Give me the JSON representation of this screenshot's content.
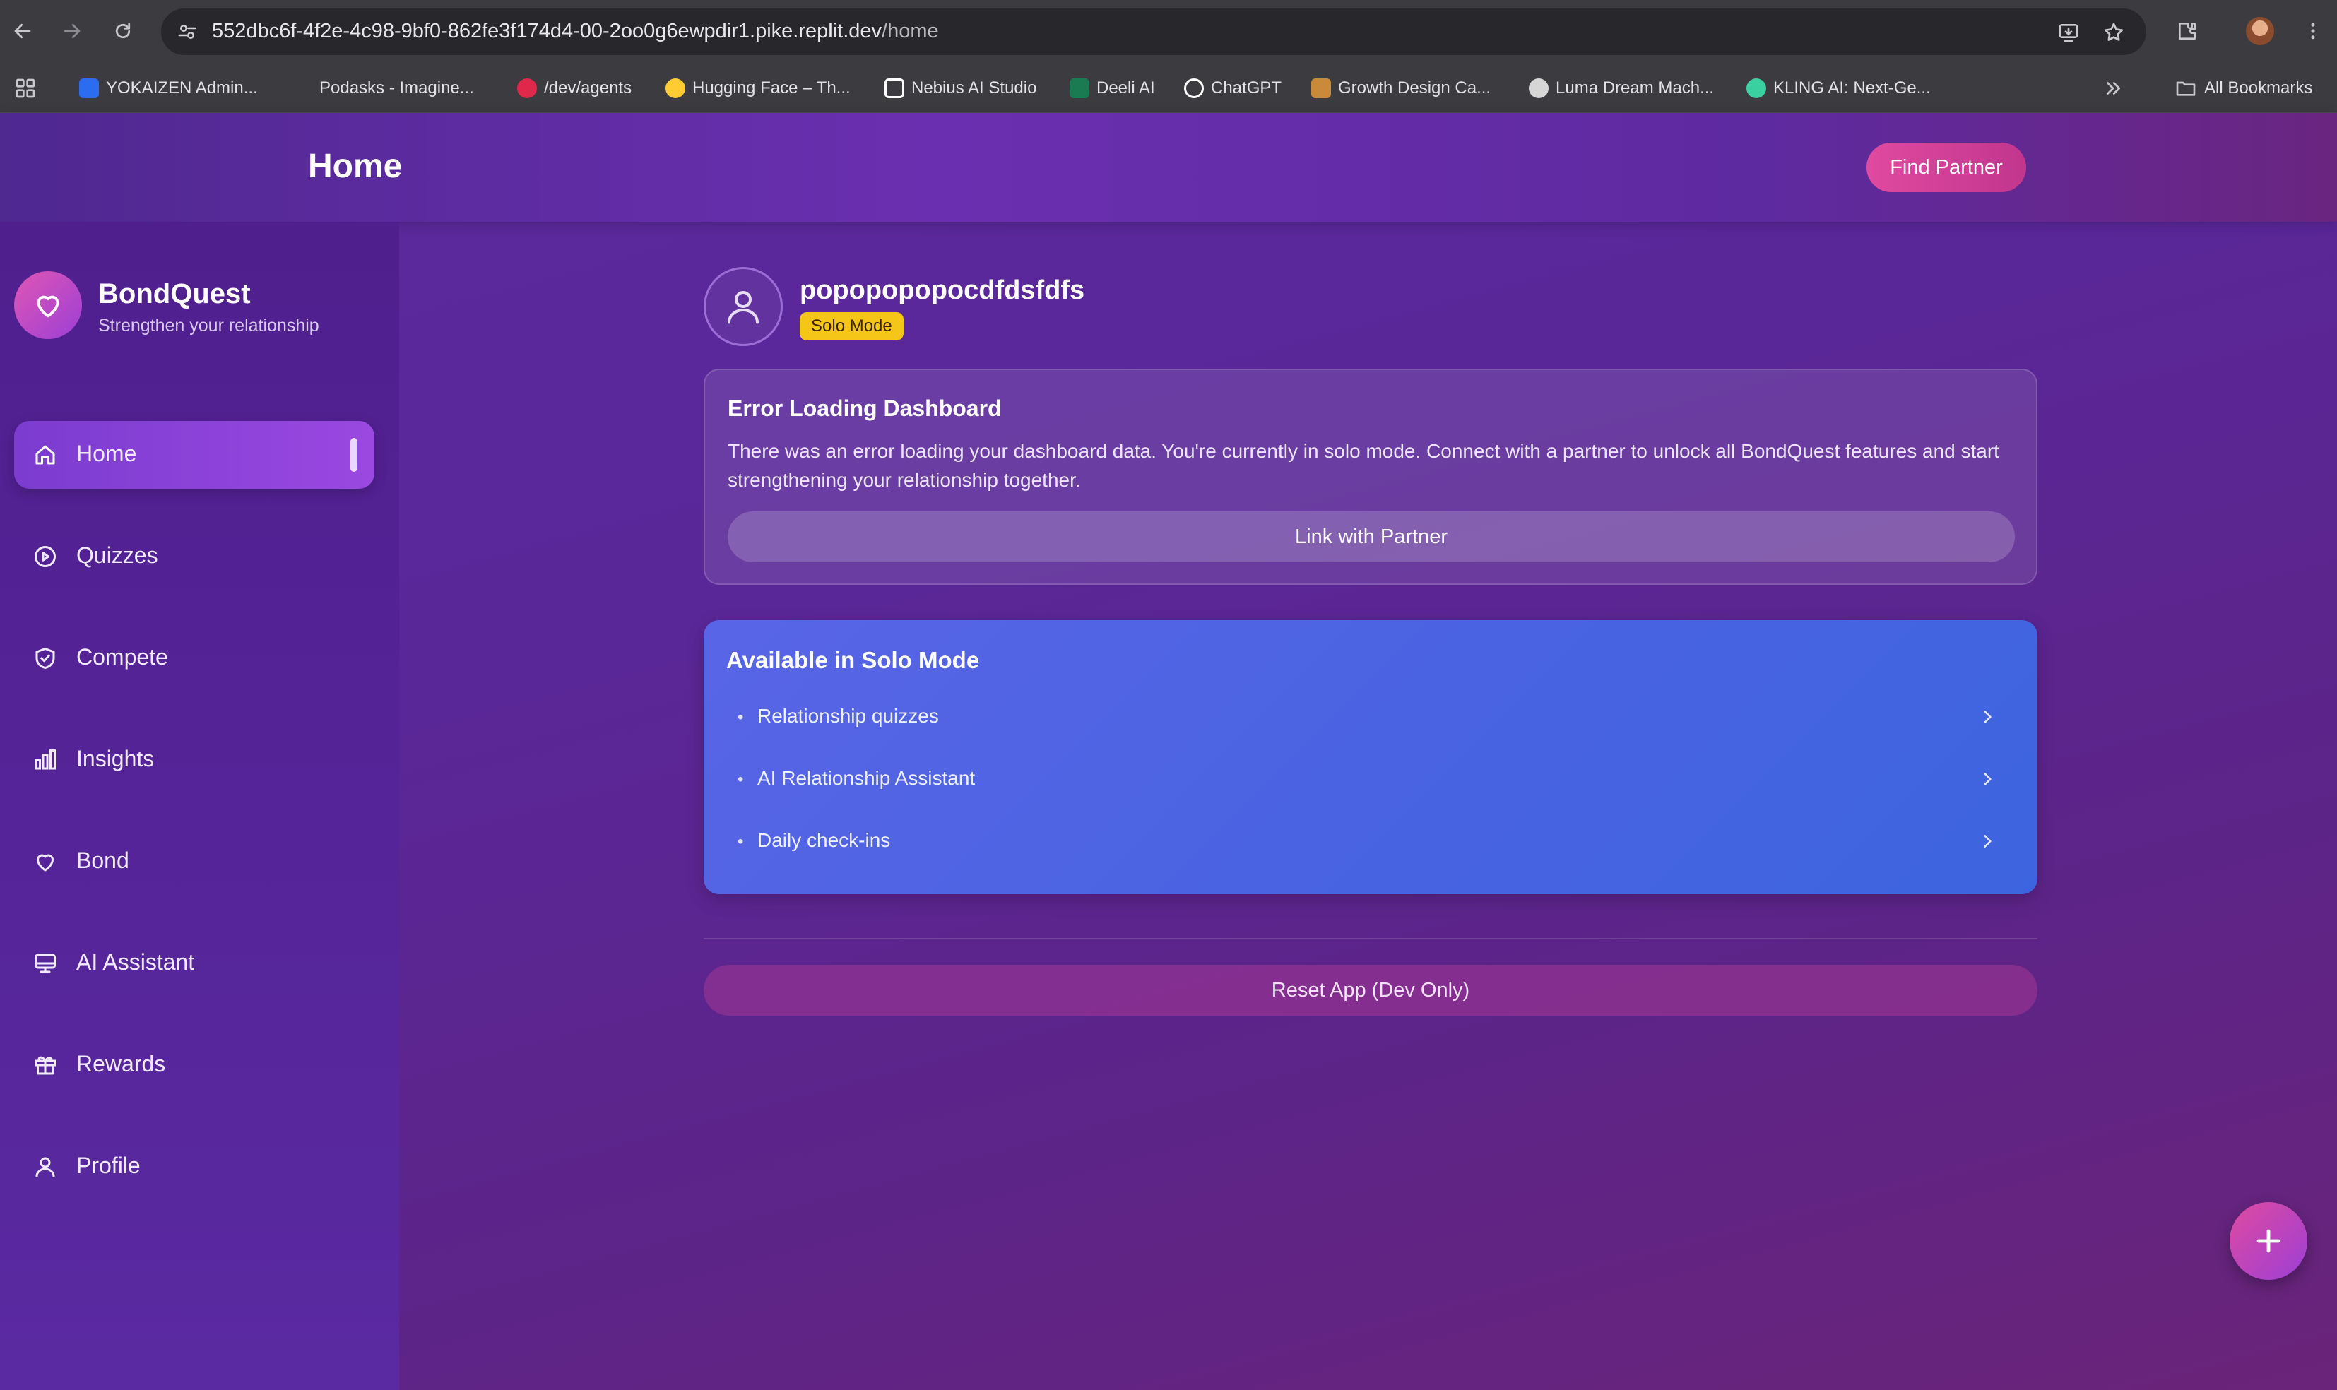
{
  "browser": {
    "url_host": "552dbc6f-4f2e-4c98-9bf0-862fe3f174d4-00-2oo0g6ewpdir1.pike.replit.dev",
    "url_path": "/home",
    "bookmarks": [
      {
        "label": "YOKAIZEN Admin...",
        "color": "#2c6cf0"
      },
      {
        "label": "Podasks - Imagine...",
        "color": "#3c3c40"
      },
      {
        "label": "/dev/agents",
        "color": "#e0284a"
      },
      {
        "label": "Hugging Face – Th...",
        "color": "#ffcc33"
      },
      {
        "label": "Nebius AI Studio",
        "color": "#ffffff"
      },
      {
        "label": "Deeli AI",
        "color": "#1a7a52"
      },
      {
        "label": "ChatGPT",
        "color": "#ffffff"
      },
      {
        "label": "Growth Design Ca...",
        "color": "#c98a3a"
      },
      {
        "label": "Luma Dream Mach...",
        "color": "#d6d6d6"
      },
      {
        "label": "KLING AI: Next-Ge...",
        "color": "#3ad0a0"
      }
    ],
    "all_bookmarks": "All Bookmarks"
  },
  "header": {
    "title": "Home",
    "find_partner": "Find Partner"
  },
  "sidebar": {
    "brand_name": "BondQuest",
    "brand_tagline": "Strengthen your relationship",
    "items": [
      {
        "label": "Home",
        "icon": "home-icon",
        "active": true
      },
      {
        "label": "Quizzes",
        "icon": "play-circle-icon"
      },
      {
        "label": "Compete",
        "icon": "shield-check-icon"
      },
      {
        "label": "Insights",
        "icon": "bar-chart-icon"
      },
      {
        "label": "Bond",
        "icon": "heart-icon"
      },
      {
        "label": "AI Assistant",
        "icon": "monitor-icon"
      },
      {
        "label": "Rewards",
        "icon": "gift-icon"
      },
      {
        "label": "Profile",
        "icon": "user-icon"
      }
    ]
  },
  "profile": {
    "username": "popopopopocdfdsfdfs",
    "mode_badge": "Solo Mode"
  },
  "error_card": {
    "title": "Error Loading Dashboard",
    "message": "There was an error loading your dashboard data. You're currently in solo mode. Connect with a partner to unlock all BondQuest features and start strengthening your relationship together.",
    "button": "Link with Partner"
  },
  "solo_card": {
    "title": "Available in Solo Mode",
    "features": [
      "Relationship quizzes",
      "AI Relationship Assistant",
      "Daily check-ins"
    ]
  },
  "reset_button": "Reset App (Dev Only)",
  "colors": {
    "accent_pink": "#e04aa0",
    "badge_yellow": "#f5c518",
    "solo_blue": "#4a63e2"
  }
}
